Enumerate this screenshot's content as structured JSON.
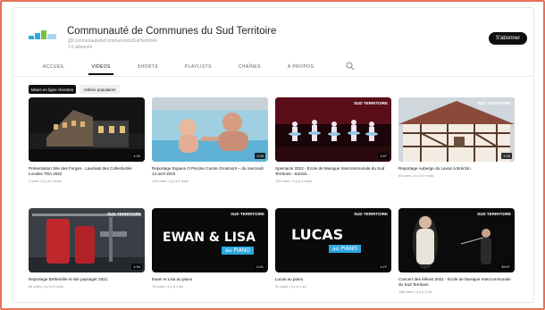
{
  "channel": {
    "name": "Communauté de Communes du Sud Territoire",
    "handle": "@CommunautedeCommunesduSudTerritoire",
    "subscribers": "1 k abonnés",
    "subscribe_label": "S'abonner"
  },
  "tabs": [
    {
      "label": "ACCUEIL"
    },
    {
      "label": "VIDÉOS"
    },
    {
      "label": "SHORTS"
    },
    {
      "label": "PLAYLISTS"
    },
    {
      "label": "CHAÎNES"
    },
    {
      "label": "À PROPOS"
    }
  ],
  "filters": {
    "recent": "Mises en ligne récentes",
    "popular": "Vidéos populaires"
  },
  "videos": [
    {
      "title": "Présentation Site des Forges - Lauréats des Collectivités Locales TDA 2022",
      "meta": "3 vues • il y a 1 mois",
      "duration": "1:20"
    },
    {
      "title": "Reportage Espace O Piscine Comte Grosmont – du mercredi 14 avril 2022",
      "meta": "193 vues • il y a 1 mois",
      "duration": "2:09"
    },
    {
      "title": "Spectacle 2022 - École de Musique Intercommunale du Sud Territoire - Extrait...",
      "meta": "102 vues • il y a 2 mois",
      "duration": "1:57"
    },
    {
      "title": "Reportage Auberge du Lavoir à Bréchin",
      "meta": "90 vues • il y a 2 mois",
      "duration": "1:34"
    },
    {
      "title": "Reportage Brétemille et site paysager 2021",
      "meta": "84 vues • il y a 9 mois",
      "duration": "1:34"
    },
    {
      "title": "Ewan et Lisa au piano",
      "meta": "74 vues • il y a 1 an",
      "duration": "0:41"
    },
    {
      "title": "Lucas au piano",
      "meta": "91 vues • il y a 1 an",
      "duration": "1:27"
    },
    {
      "title": "Concert des élèves 2021 - École de Musique Intercommunale du Sud Territoire",
      "meta": "158 vues • il y a 1 an",
      "duration": "39:57"
    }
  ],
  "thumb_texts": {
    "badge": "SUD TERRITOIRE",
    "ewan_lisa": "EWAN & LISA",
    "lucas": "LUCAS",
    "au_piano": "au PIANO"
  },
  "colors": {
    "frame": "#e8715a",
    "accent_blue": "#2ba8e0"
  }
}
